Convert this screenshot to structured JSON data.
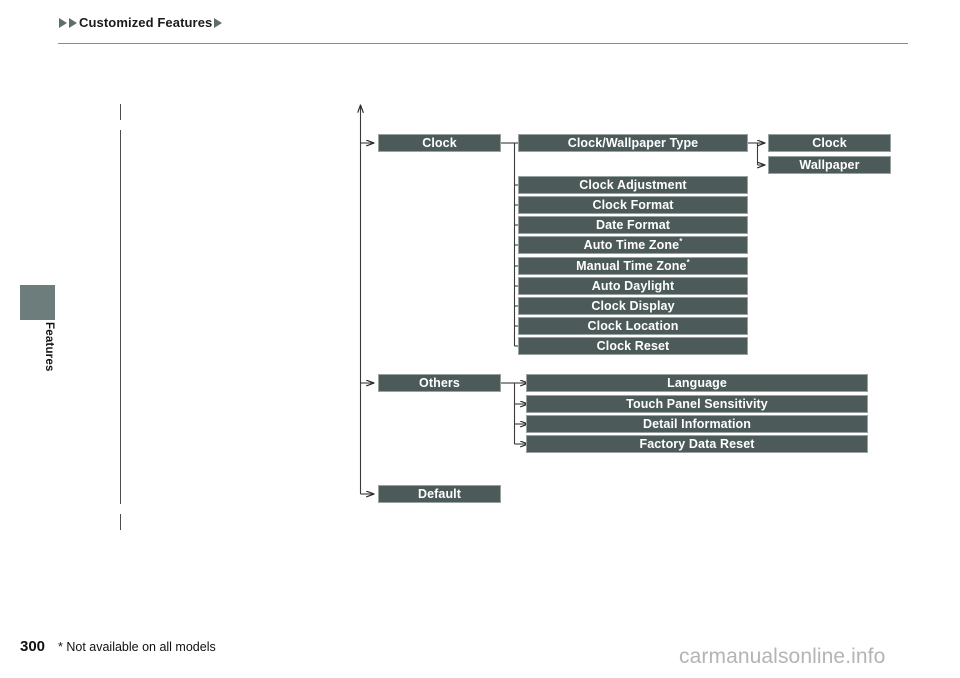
{
  "header": {
    "marker_left_1": "▶",
    "marker_left_2": "▶",
    "title": "Customized Features",
    "marker_right": "▶"
  },
  "sidebar": {
    "section_label": "Features"
  },
  "chart": {
    "level1": [
      {
        "label": "Clock",
        "name": "node-clock"
      },
      {
        "label": "Others",
        "name": "node-others"
      },
      {
        "label": "Default",
        "name": "node-default"
      }
    ],
    "clock_children": [
      {
        "label": "Clock/Wallpaper Type",
        "asterisk": false
      },
      {
        "label": "Clock Adjustment",
        "asterisk": false
      },
      {
        "label": "Clock Format",
        "asterisk": false
      },
      {
        "label": "Date Format",
        "asterisk": false
      },
      {
        "label": "Auto Time Zone",
        "asterisk": true
      },
      {
        "label": "Manual Time Zone",
        "asterisk": true
      },
      {
        "label": "Auto Daylight",
        "asterisk": false
      },
      {
        "label": "Clock Display",
        "asterisk": false
      },
      {
        "label": "Clock Location",
        "asterisk": false
      },
      {
        "label": "Clock Reset",
        "asterisk": false
      }
    ],
    "clock_wallpaper_type_children": [
      {
        "label": "Clock"
      },
      {
        "label": "Wallpaper"
      }
    ],
    "others_children": [
      {
        "label": "Language"
      },
      {
        "label": "Touch Panel Sensitivity"
      },
      {
        "label": "Detail Information"
      },
      {
        "label": "Factory Data Reset"
      }
    ],
    "asterisk_mark": "*"
  },
  "footer": {
    "page_number": "300",
    "footnote": "* Not available on all models",
    "watermark": "carmanualsonline.info"
  },
  "colors": {
    "box_fill": "#4c5a59",
    "box_border": "#98a2a1",
    "tab_fill": "#6d7d7c",
    "rule": "#8b8b8b",
    "watermark": "#b4b4b4"
  }
}
